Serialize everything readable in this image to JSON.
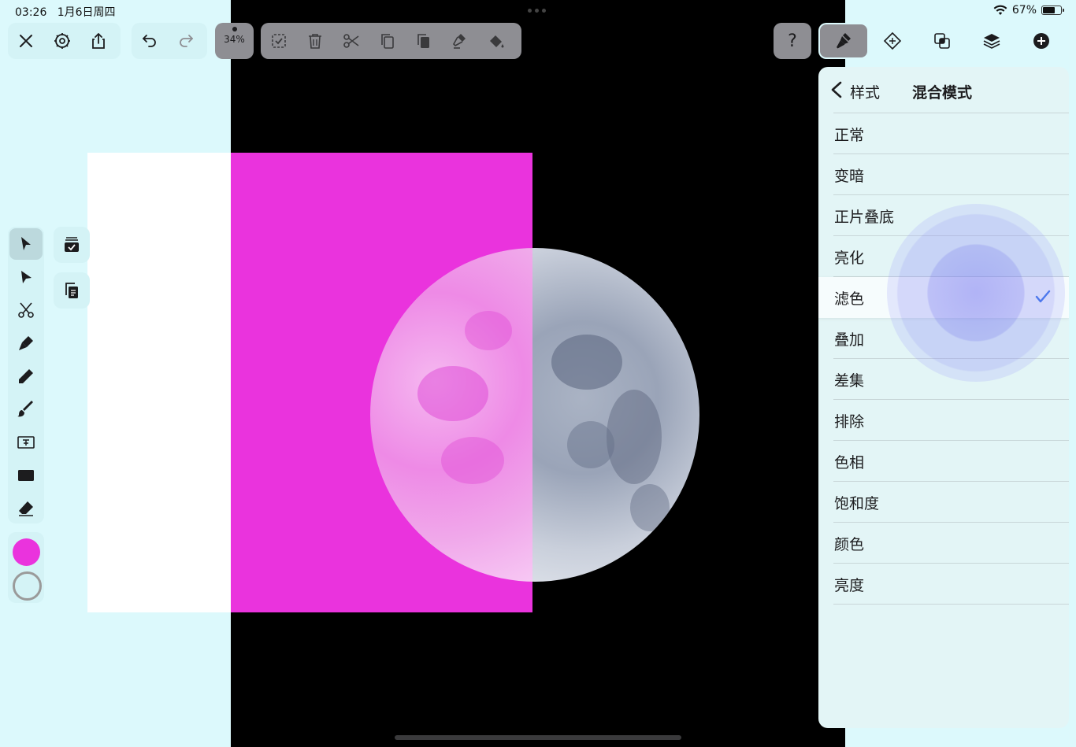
{
  "status": {
    "time": "03:26",
    "date": "1月6日周四",
    "battery": "67%",
    "battery_level": 0.67
  },
  "toolbar": {
    "zoom": "34%",
    "help": "?"
  },
  "colors": {
    "fill": "#ea33dd",
    "accent": "#2f6fe8"
  },
  "icons": {
    "left_group": [
      "close-icon",
      "settings-icon",
      "share-icon"
    ],
    "history_group": [
      "undo-icon",
      "redo-icon"
    ],
    "edit_group": [
      "select-check-icon",
      "trash-icon",
      "scissors-icon",
      "copy-icon",
      "duplicate-icon",
      "paste-style-icon",
      "fill-bucket-icon"
    ],
    "right_group": [
      "style-brush-icon",
      "transform-icon",
      "boolean-icon",
      "layers-icon",
      "add-icon"
    ],
    "palette": [
      "pointer-arrow-icon",
      "direct-select-icon",
      "scissors-pen-icon",
      "pen-icon",
      "pencil-icon",
      "brush-icon",
      "text-icon",
      "rectangle-icon",
      "eraser-icon"
    ]
  },
  "panel": {
    "back_label": "样式",
    "title": "混合模式",
    "modes": [
      "正常",
      "变暗",
      "正片叠底",
      "亮化",
      "滤色",
      "叠加",
      "差集",
      "排除",
      "色相",
      "饱和度",
      "颜色",
      "亮度"
    ],
    "selected_index": 4
  }
}
